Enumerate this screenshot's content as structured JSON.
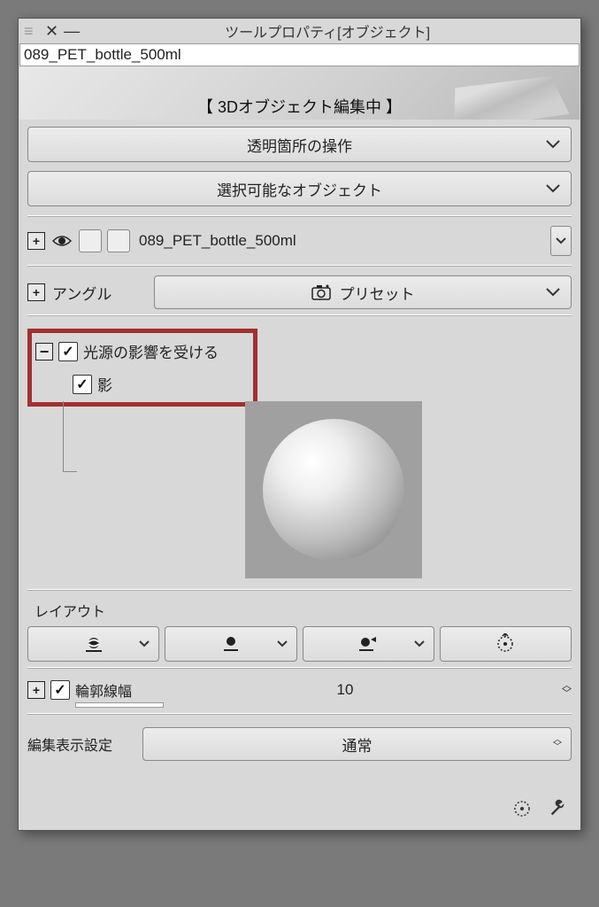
{
  "titlebar": {
    "title": "ツールプロパティ[オブジェクト]"
  },
  "filename": "089_PET_bottle_500ml",
  "banner": "【 3Dオブジェクト編集中 】",
  "buttons": {
    "transparent_op": "透明箇所の操作",
    "selectable_obj": "選択可能なオブジェクト"
  },
  "object_name": "089_PET_bottle_500ml",
  "angle": {
    "label": "アングル",
    "preset": "プリセット"
  },
  "light": {
    "affected_label": "光源の影響を受ける",
    "shadow_label": "影",
    "affected_checked": true,
    "shadow_checked": true
  },
  "layout": {
    "label": "レイアウト"
  },
  "outline": {
    "label": "輪郭線幅",
    "value": "10",
    "checked": true
  },
  "render": {
    "label": "編集表示設定",
    "value": "通常"
  }
}
